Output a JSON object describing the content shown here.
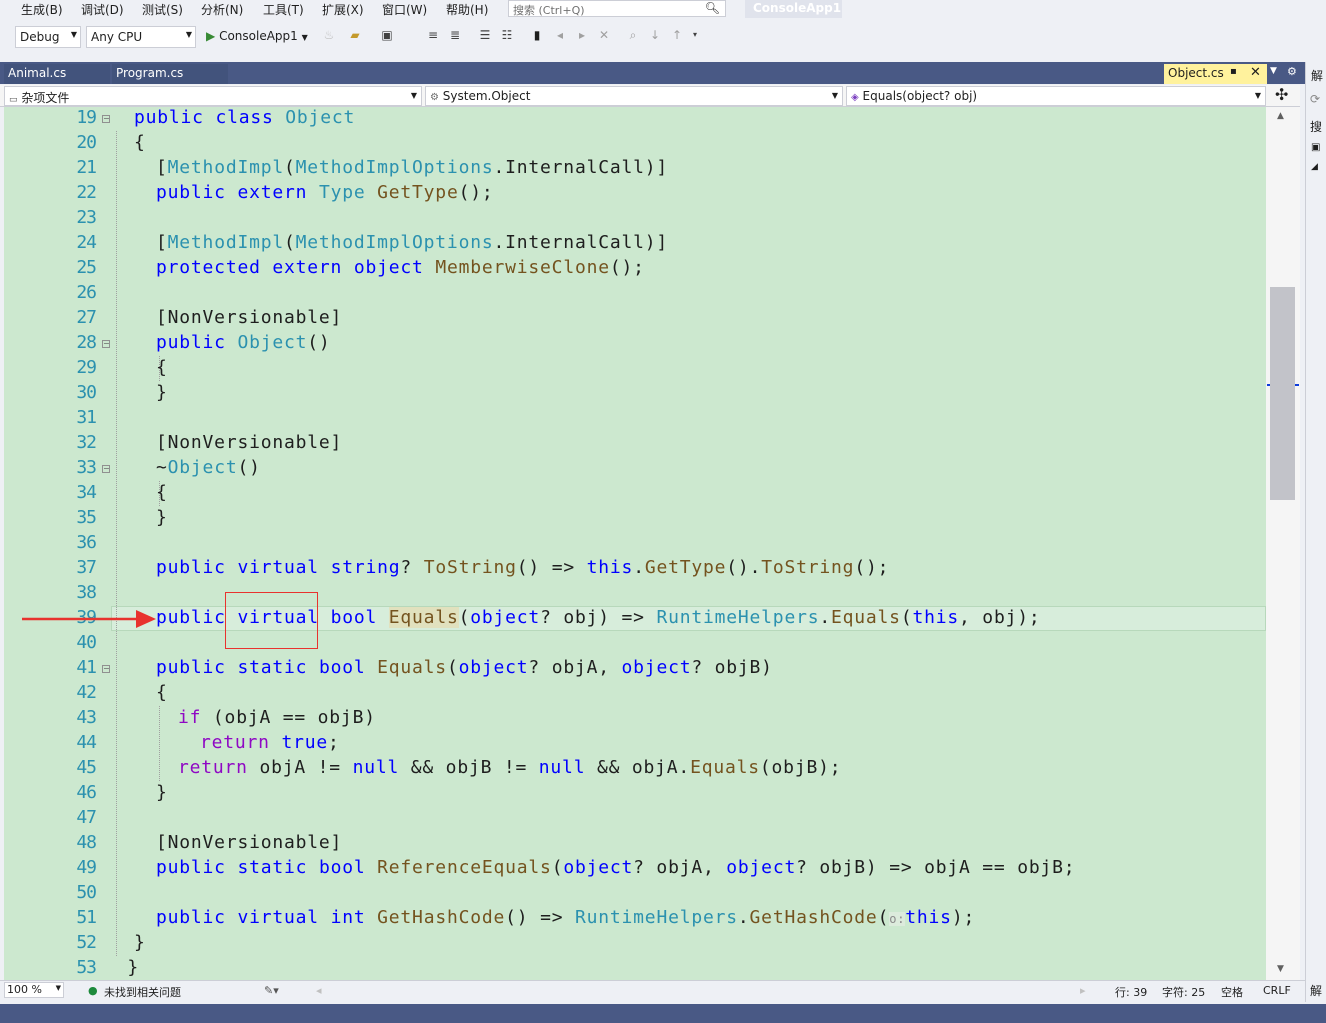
{
  "menu": [
    "生成(B)",
    "调试(D)",
    "测试(S)",
    "分析(N)",
    "工具(T)",
    "扩展(X)",
    "窗口(W)",
    "帮助(H)"
  ],
  "search": {
    "placeholder": "搜索 (Ctrl+Q)"
  },
  "project_badge": "ConsoleApp1",
  "toolbar": {
    "config": "Debug",
    "platform": "Any CPU",
    "run_target": "ConsoleApp1"
  },
  "tabs": {
    "left": [
      "Animal.cs",
      "Program.cs"
    ],
    "active": "Object.cs"
  },
  "navbar": {
    "scope": "杂项文件",
    "type": "System.Object",
    "member": "Equals(object? obj)"
  },
  "right_panel": {
    "tab_top": "解",
    "search": "搜",
    "tab_bottom": "解"
  },
  "editor": {
    "line_numbers": [
      "19",
      "20",
      "21",
      "22",
      "23",
      "24",
      "25",
      "26",
      "27",
      "28",
      "29",
      "30",
      "31",
      "32",
      "33",
      "34",
      "35",
      "36",
      "37",
      "38",
      "39",
      "40",
      "41",
      "42",
      "43",
      "44",
      "45",
      "46",
      "47",
      "48",
      "49",
      "50",
      "51",
      "52",
      "53"
    ],
    "lines": [
      [
        [
          "kw",
          "public "
        ],
        [
          "kw",
          "class "
        ],
        [
          "tp",
          "Object"
        ]
      ],
      [
        [
          "",
          "{"
        ]
      ],
      [
        [
          "",
          "["
        ],
        [
          "tp",
          "MethodImpl"
        ],
        [
          "",
          "("
        ],
        [
          "tp",
          "MethodImplOptions"
        ],
        [
          "",
          ".InternalCall)]"
        ]
      ],
      [
        [
          "kw",
          "public "
        ],
        [
          "kw",
          "extern "
        ],
        [
          "tp",
          "Type "
        ],
        [
          "mt",
          "GetType"
        ],
        [
          "",
          "();"
        ]
      ],
      [],
      [
        [
          "",
          "["
        ],
        [
          "tp",
          "MethodImpl"
        ],
        [
          "",
          "("
        ],
        [
          "tp",
          "MethodImplOptions"
        ],
        [
          "",
          ".InternalCall)]"
        ]
      ],
      [
        [
          "kw",
          "protected "
        ],
        [
          "kw",
          "extern "
        ],
        [
          "kw",
          "object "
        ],
        [
          "mt",
          "MemberwiseClone"
        ],
        [
          "",
          "();"
        ]
      ],
      [],
      [
        [
          "",
          "[NonVersionable]"
        ]
      ],
      [
        [
          "kw",
          "public "
        ],
        [
          "tp",
          "Object"
        ],
        [
          "",
          "()"
        ]
      ],
      [
        [
          "",
          "{"
        ]
      ],
      [
        [
          "",
          "}"
        ]
      ],
      [],
      [
        [
          "",
          "[NonVersionable]"
        ]
      ],
      [
        [
          "",
          "~"
        ],
        [
          "tp",
          "Object"
        ],
        [
          "",
          "()"
        ]
      ],
      [
        [
          "",
          "{"
        ]
      ],
      [
        [
          "",
          "}"
        ]
      ],
      [],
      [
        [
          "kw",
          "public "
        ],
        [
          "kw",
          "virtual "
        ],
        [
          "kw",
          "string"
        ],
        [
          "",
          "? "
        ],
        [
          "mt",
          "ToString"
        ],
        [
          "",
          "() => "
        ],
        [
          "kw",
          "this"
        ],
        [
          "",
          "."
        ],
        [
          "mt",
          "GetType"
        ],
        [
          "",
          "()."
        ],
        [
          "mt",
          "ToString"
        ],
        [
          "",
          "();"
        ]
      ],
      [],
      [
        [
          "kw",
          "public "
        ],
        [
          "kw",
          "virtual "
        ],
        [
          "kw",
          "bool "
        ],
        [
          "mt",
          "Equals"
        ],
        [
          "",
          "("
        ],
        [
          "kw",
          "object"
        ],
        [
          "",
          "? obj) => "
        ],
        [
          "tp",
          "RuntimeHelpers"
        ],
        [
          "",
          "."
        ],
        [
          "mt",
          "Equals"
        ],
        [
          "",
          "("
        ],
        [
          "kw",
          "this"
        ],
        [
          "",
          ", obj);"
        ]
      ],
      [],
      [
        [
          "kw",
          "public "
        ],
        [
          "kw",
          "static "
        ],
        [
          "kw",
          "bool "
        ],
        [
          "mt",
          "Equals"
        ],
        [
          "",
          "("
        ],
        [
          "kw",
          "object"
        ],
        [
          "",
          "? objA, "
        ],
        [
          "kw",
          "object"
        ],
        [
          "",
          "? objB)"
        ]
      ],
      [
        [
          "",
          "{"
        ]
      ],
      [
        [
          "ctl",
          "if "
        ],
        [
          "",
          "(objA == objB)"
        ]
      ],
      [
        [
          "ctl",
          "return "
        ],
        [
          "kw",
          "true"
        ],
        [
          "",
          ";"
        ]
      ],
      [
        [
          "ctl",
          "return "
        ],
        [
          "",
          "objA != "
        ],
        [
          "kw",
          "null "
        ],
        [
          "",
          "&& objB != "
        ],
        [
          "kw",
          "null "
        ],
        [
          "",
          "&& objA."
        ],
        [
          "mt",
          "Equals"
        ],
        [
          "",
          "(objB);"
        ]
      ],
      [
        [
          "",
          "}"
        ]
      ],
      [],
      [
        [
          "",
          "[NonVersionable]"
        ]
      ],
      [
        [
          "kw",
          "public "
        ],
        [
          "kw",
          "static "
        ],
        [
          "kw",
          "bool "
        ],
        [
          "mt",
          "ReferenceEquals"
        ],
        [
          "",
          "("
        ],
        [
          "kw",
          "object"
        ],
        [
          "",
          "? objA, "
        ],
        [
          "kw",
          "object"
        ],
        [
          "",
          "? objB) => objA == objB;"
        ]
      ],
      [],
      [
        [
          "kw",
          "public "
        ],
        [
          "kw",
          "virtual "
        ],
        [
          "kw",
          "int "
        ],
        [
          "mt",
          "GetHashCode"
        ],
        [
          "",
          "() => "
        ],
        [
          "tp",
          "RuntimeHelpers"
        ],
        [
          "",
          "."
        ],
        [
          "mt",
          "GetHashCode"
        ],
        [
          "",
          "("
        ],
        [
          "",
          "o:"
        ],
        [
          "kw",
          "this"
        ],
        [
          "",
          ");"
        ]
      ],
      [
        [
          "",
          "}"
        ]
      ],
      [
        [
          "",
          "}"
        ]
      ]
    ]
  },
  "status": {
    "zoom": "100 %",
    "issues": "未找到相关问题",
    "line": "行: 39",
    "char": "字符: 25",
    "spaces": "空格",
    "eol": "CRLF"
  },
  "colors": {
    "editor_bg": "#cce8cf",
    "keyword": "#0000ff",
    "type": "#2b91af",
    "method": "#74531f",
    "control": "#8f08c4",
    "annotation": "#e8322e"
  }
}
